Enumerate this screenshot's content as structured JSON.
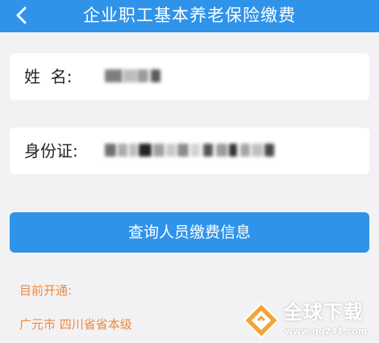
{
  "header": {
    "title": "企业职工基本养老保险缴费",
    "back_icon": "chevron-left-icon",
    "color": "#2f93ea"
  },
  "form": {
    "name_label": "姓  名:",
    "name_value": "",
    "id_label": "身份证:",
    "id_value": ""
  },
  "actions": {
    "query_label": "查询人员缴费信息"
  },
  "info": {
    "open_label": "目前开通:",
    "region": "广元市 四川省省本级"
  },
  "watermark": {
    "title": "全球下载",
    "url": "www.qq241.com",
    "logo_icon": "watermark-logo-icon"
  },
  "colors": {
    "accent": "#2f93ea",
    "notice": "#f08a3c",
    "background": "#f2f2f4"
  }
}
